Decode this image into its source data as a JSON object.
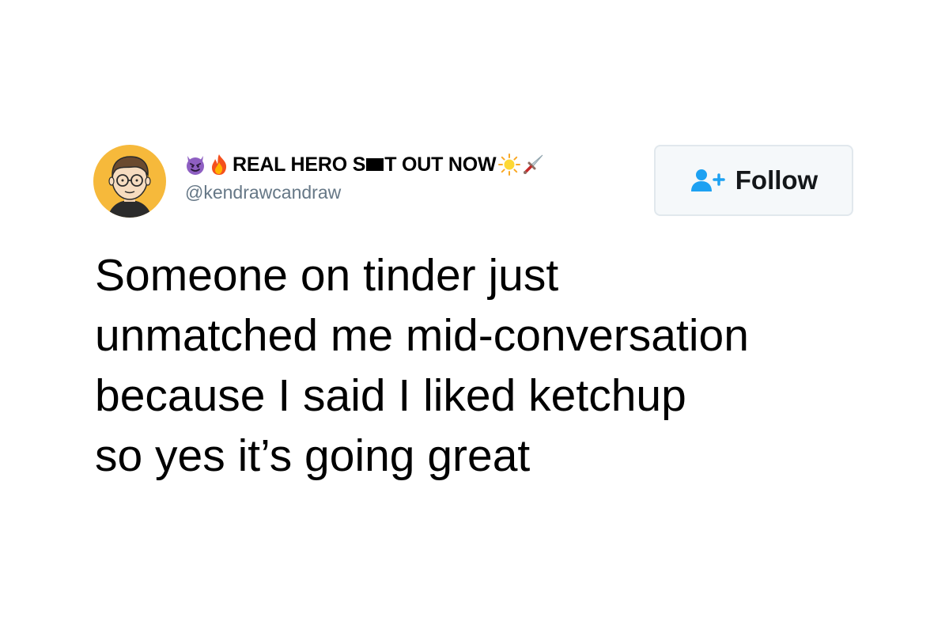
{
  "tweet": {
    "author": {
      "display_name_part1": "REAL HERO S",
      "display_name_part2": "T OUT NOW",
      "handle": "@kendrawcandraw",
      "name_emojis_leading": [
        "smiling-devil-icon",
        "fire-icon"
      ],
      "name_emojis_trailing": [
        "sun-icon",
        "dagger-icon"
      ]
    },
    "follow_button": {
      "label": "Follow",
      "icon": "add-user-icon"
    },
    "text_lines": [
      "Someone on tinder just",
      "unmatched me mid-conversation",
      "because I said I liked ketchup",
      "so yes it’s going great"
    ]
  },
  "colors": {
    "background": "#ffffff",
    "text": "#000000",
    "handle": "#657786",
    "accent": "#1da1f2",
    "button_bg": "#f5f8fa",
    "button_border": "#e1e8ed",
    "avatar_bg": "#f7b731"
  }
}
